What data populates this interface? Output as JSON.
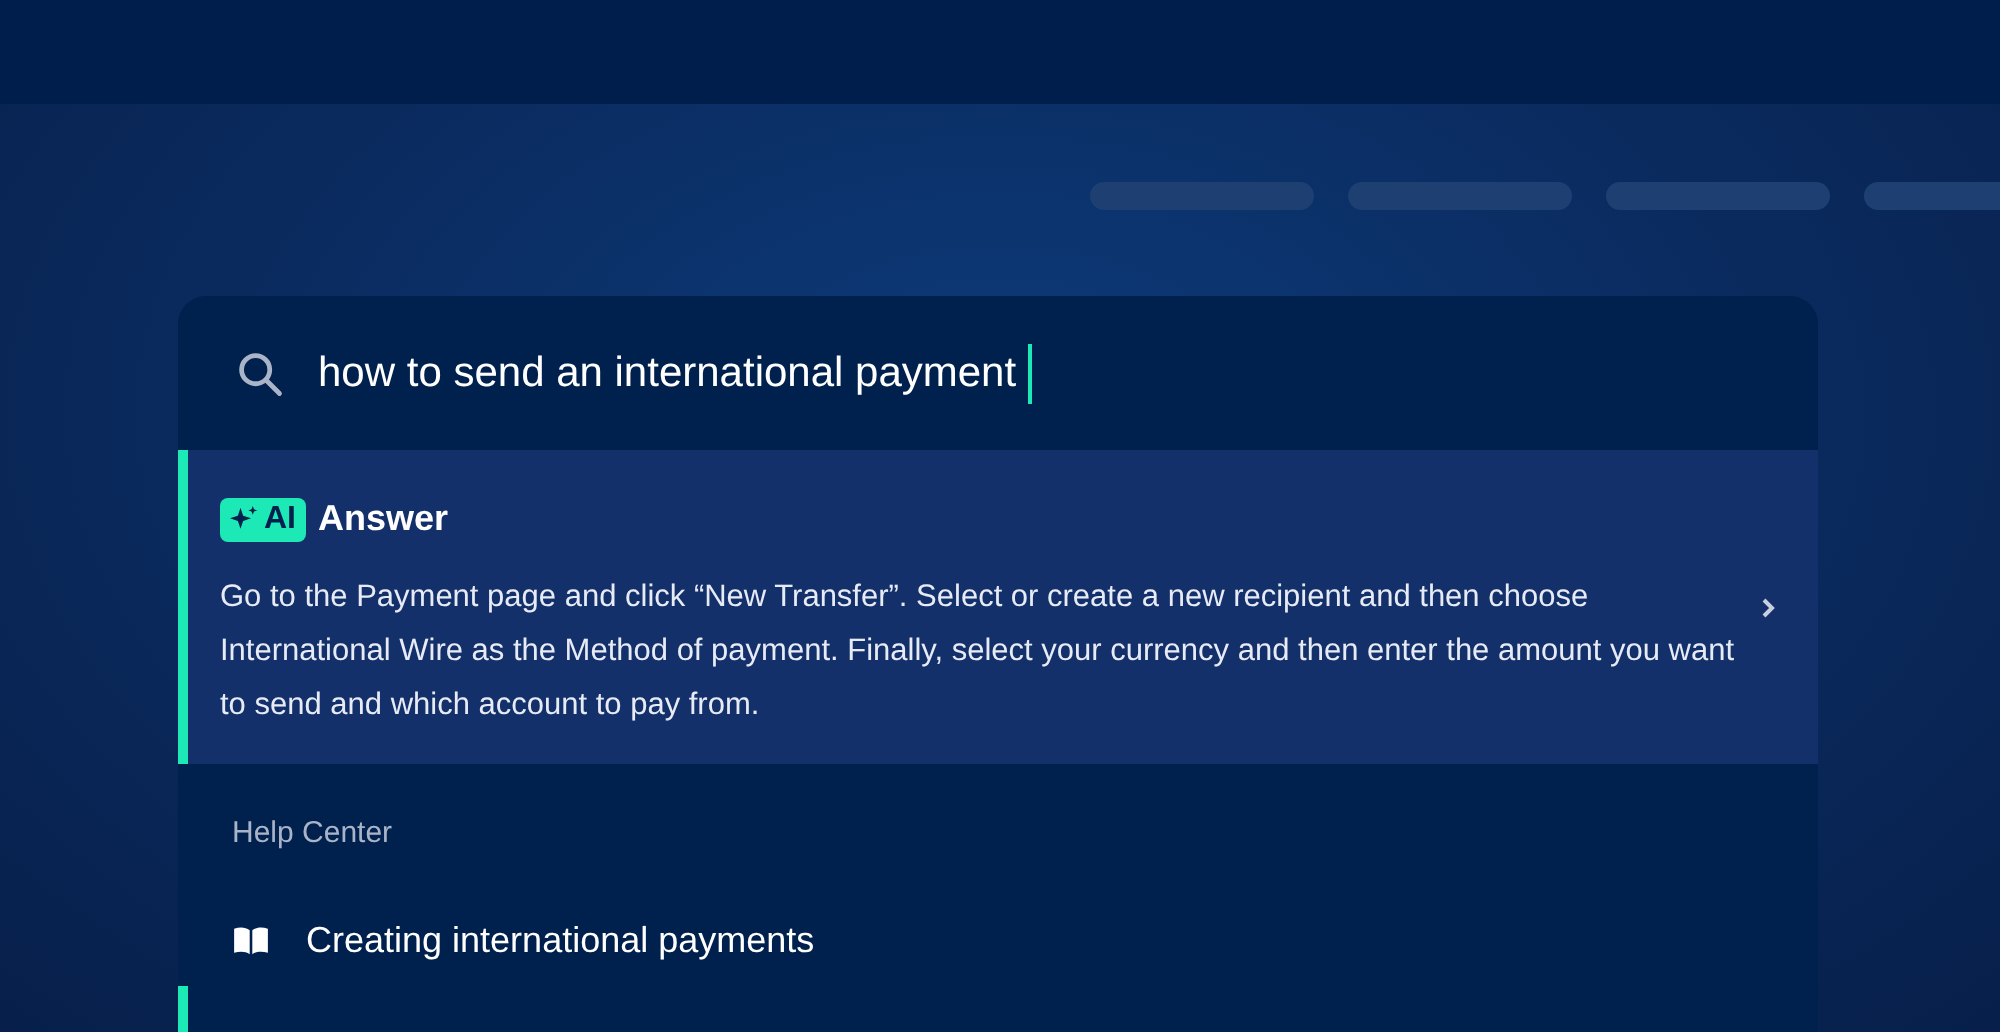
{
  "search": {
    "value": "how to send an international payment"
  },
  "ai_answer": {
    "badge": "AI",
    "title": "Answer",
    "text": "Go to the Payment page and click “New Transfer”. Select or create a new recipient and then choose International Wire as the Method of payment. Finally, select your currency and then enter the amount you want to send and which account to pay from."
  },
  "help_center": {
    "heading": "Help Center",
    "results": [
      {
        "label": "Creating international payments"
      }
    ]
  }
}
